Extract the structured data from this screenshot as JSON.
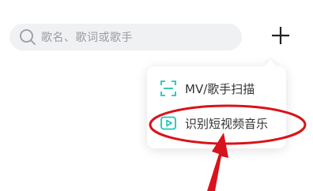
{
  "search": {
    "placeholder": "歌名、歌词或歌手",
    "icon": "search-icon"
  },
  "header": {
    "add_icon": "plus-icon"
  },
  "menu": {
    "items": [
      {
        "label": "MV/歌手扫描",
        "icon": "scan-icon"
      },
      {
        "label": "识别短视频音乐",
        "icon": "video-play-icon"
      }
    ]
  },
  "colors": {
    "accent": "#1cc7b7",
    "annotation": "#d8131b",
    "search_bg": "#f0f1f3",
    "placeholder_text": "#9a9ca3",
    "menu_text": "#333333"
  }
}
